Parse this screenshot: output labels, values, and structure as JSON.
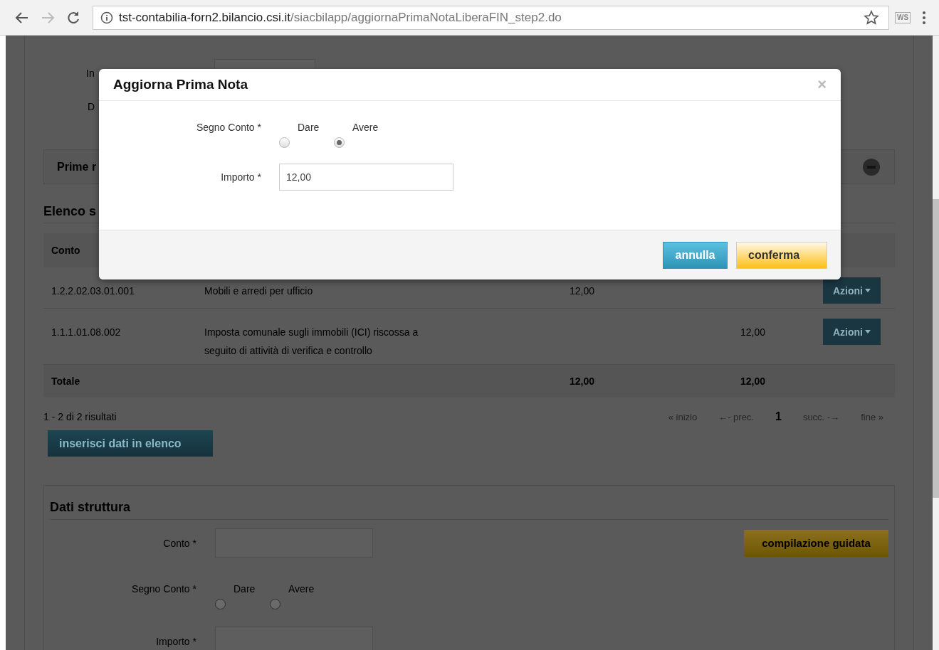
{
  "browser": {
    "url_host": "tst-contabilia-forn2.bilancio.csi.it",
    "url_path": "/siacbilapp/aggiornaPrimaNotaLiberaFIN_step2.do",
    "extension_label": "WS"
  },
  "background": {
    "form_labels": [
      "In",
      "D"
    ],
    "panel_title": "Prime r",
    "list_title": "Elenco s",
    "table": {
      "columns": [
        "Conto"
      ],
      "rows": [
        {
          "conto": "1.2.2.02.03.01.001",
          "descrizione": "Mobili e arredi per ufficio",
          "dare": "12,00",
          "avere": "",
          "action": "Azioni"
        },
        {
          "conto": "1.1.1.01.08.002",
          "descrizione": "Imposta comunale sugli immobili (ICI) riscossa a seguito di attività di verifica e controllo",
          "dare": "",
          "avere": "12,00",
          "action": "Azioni"
        }
      ],
      "total": {
        "label": "Totale",
        "dare": "12,00",
        "avere": "12,00"
      }
    },
    "results": "1 - 2 di 2 risultati",
    "pagination": [
      {
        "label": "« inizio",
        "selected": false
      },
      {
        "label": "←- prec.",
        "selected": false
      },
      {
        "label": "1",
        "selected": true
      },
      {
        "label": "succ. -→",
        "selected": false
      },
      {
        "label": "fine »",
        "selected": false
      }
    ],
    "insert_button": "inserisci dati in elenco",
    "struttura": {
      "title": "Dati struttura",
      "conto_label": "Conto *",
      "guided_button": "compilazione guidata",
      "segno_label": "Segno Conto *",
      "options": [
        {
          "label": "Dare",
          "selected": false
        },
        {
          "label": "Avere",
          "selected": false
        }
      ],
      "importo_label": "Importo *"
    }
  },
  "modal": {
    "title": "Aggiorna Prima Nota",
    "close": "×",
    "segno_label": "Segno Conto *",
    "options": [
      {
        "label": "Dare",
        "selected": false
      },
      {
        "label": "Avere",
        "selected": true
      }
    ],
    "importo_label": "Importo *",
    "importo_value": "12,00",
    "buttons": [
      {
        "label": "annulla",
        "kind": "secondary"
      },
      {
        "label": "conferma",
        "kind": "primary"
      }
    ]
  }
}
